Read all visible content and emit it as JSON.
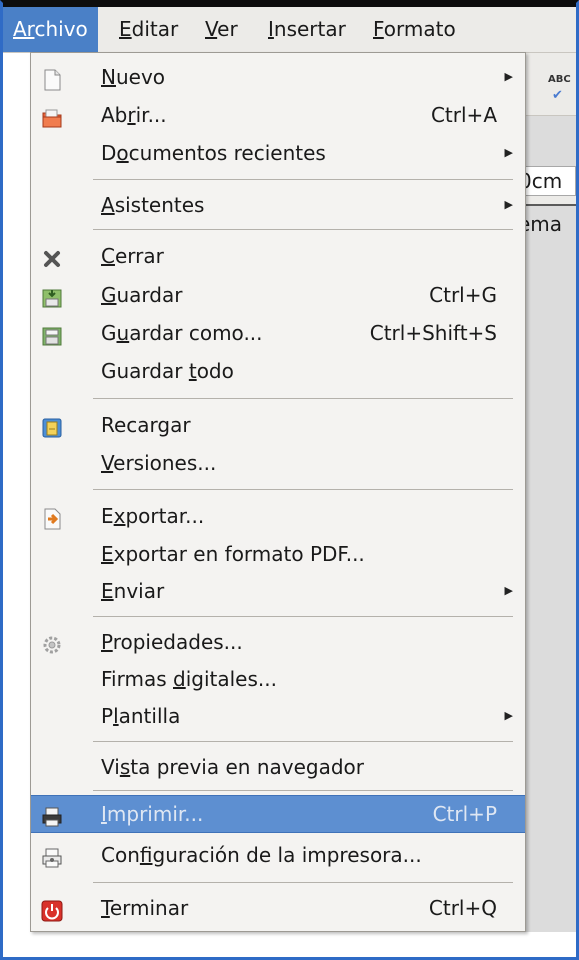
{
  "menubar": {
    "items": [
      {
        "label": "Archivo",
        "mnemonic": "Ar"
      },
      {
        "label": "Editar",
        "mnemonic": "E"
      },
      {
        "label": "Ver",
        "mnemonic": "V"
      },
      {
        "label": "Insertar",
        "mnemonic": "I"
      },
      {
        "label": "Formato",
        "mnemonic": "F"
      }
    ],
    "active": "Archivo"
  },
  "background": {
    "field_text": "0cm",
    "panel_text": "ema"
  },
  "file_menu": {
    "items": [
      {
        "id": "nuevo",
        "label": "Nuevo",
        "shortcut": "",
        "submenu": true,
        "icon": "new-document-icon"
      },
      {
        "id": "abrir",
        "label": "Abrir...",
        "shortcut": "Ctrl+A",
        "submenu": false,
        "icon": "open-folder-icon"
      },
      {
        "id": "documentos-recientes",
        "label": "Documentos recientes",
        "shortcut": "",
        "submenu": true,
        "icon": ""
      },
      {
        "id": "asistentes",
        "label": "Asistentes",
        "shortcut": "",
        "submenu": true,
        "icon": ""
      },
      {
        "id": "cerrar",
        "label": "Cerrar",
        "shortcut": "",
        "submenu": false,
        "icon": "close-x-icon"
      },
      {
        "id": "guardar",
        "label": "Guardar",
        "shortcut": "Ctrl+G",
        "submenu": false,
        "icon": "save-icon"
      },
      {
        "id": "guardar-como",
        "label": "Guardar como...",
        "shortcut": "Ctrl+Shift+S",
        "submenu": false,
        "icon": "save-as-icon"
      },
      {
        "id": "guardar-todo",
        "label": "Guardar todo",
        "shortcut": "",
        "submenu": false,
        "icon": ""
      },
      {
        "id": "recargar",
        "label": "Recargar",
        "shortcut": "",
        "submenu": false,
        "icon": "reload-icon"
      },
      {
        "id": "versiones",
        "label": "Versiones...",
        "shortcut": "",
        "submenu": false,
        "icon": ""
      },
      {
        "id": "exportar",
        "label": "Exportar...",
        "shortcut": "",
        "submenu": false,
        "icon": "export-icon"
      },
      {
        "id": "exportar-pdf",
        "label": "Exportar en formato PDF...",
        "shortcut": "",
        "submenu": false,
        "icon": ""
      },
      {
        "id": "enviar",
        "label": "Enviar",
        "shortcut": "",
        "submenu": true,
        "icon": ""
      },
      {
        "id": "propiedades",
        "label": "Propiedades...",
        "shortcut": "",
        "submenu": false,
        "icon": "properties-gear-icon"
      },
      {
        "id": "firmas-digitales",
        "label": "Firmas digitales...",
        "shortcut": "",
        "submenu": false,
        "icon": ""
      },
      {
        "id": "plantilla",
        "label": "Plantilla",
        "shortcut": "",
        "submenu": true,
        "icon": ""
      },
      {
        "id": "vista-previa",
        "label": "Vista previa en navegador",
        "shortcut": "",
        "submenu": false,
        "icon": ""
      },
      {
        "id": "imprimir",
        "label": "Imprimir...",
        "shortcut": "Ctrl+P",
        "submenu": false,
        "icon": "printer-icon",
        "state": "highlighted-disabled"
      },
      {
        "id": "config-impresora",
        "label": "Configuración de la impresora...",
        "shortcut": "",
        "submenu": false,
        "icon": "printer-settings-icon"
      },
      {
        "id": "terminar",
        "label": "Terminar",
        "shortcut": "Ctrl+Q",
        "submenu": false,
        "icon": "power-icon"
      }
    ]
  },
  "colors": {
    "accent": "#4a80c7",
    "highlight": "#5d8fd1",
    "frame": "#2f6bc6",
    "disabled_text": "#9a9a9a"
  }
}
